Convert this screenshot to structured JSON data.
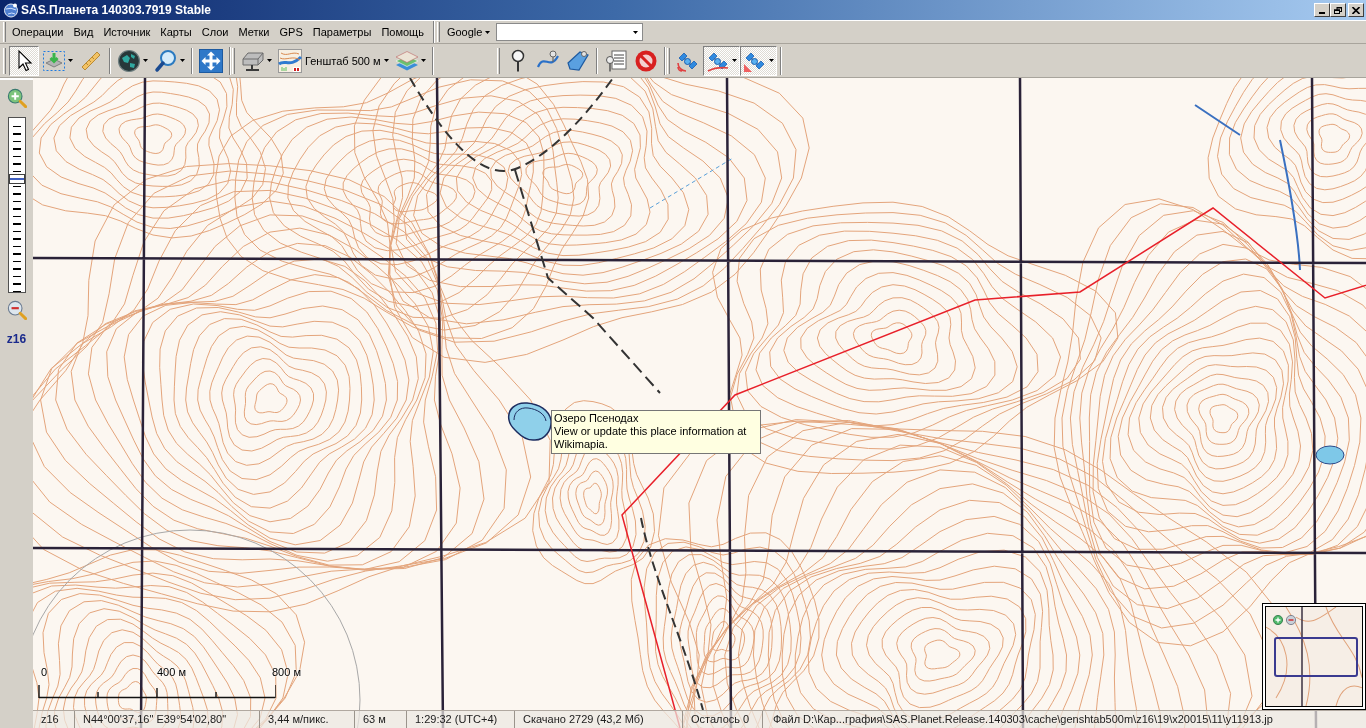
{
  "window": {
    "title": "SAS.Планета 140303.7919 Stable"
  },
  "menu": {
    "items": [
      "Операции",
      "Вид",
      "Источник",
      "Карты",
      "Слои",
      "Метки",
      "GPS",
      "Параметры",
      "Помощь"
    ]
  },
  "search_toolbar": {
    "provider": "Google"
  },
  "toolbars": [
    {
      "groups": [
        {
          "buttons": [
            {
              "pressed": true,
              "dropdown": false
            },
            {
              "pressed": false,
              "dropdown": true
            },
            {
              "pressed": false,
              "dropdown": false
            }
          ]
        },
        {
          "buttons": [
            {
              "pressed": false,
              "dropdown": true
            },
            {
              "pressed": false,
              "dropdown": true
            }
          ]
        },
        {
          "buttons": [
            {
              "pressed": false,
              "dropdown": false
            }
          ]
        }
      ]
    },
    {
      "groups": [
        {
          "buttons": [
            {
              "pressed": false,
              "dropdown": true
            },
            {
              "pressed": false,
              "dropdown": true,
              "label": "Генштаб 500 м"
            },
            {
              "pressed": false,
              "dropdown": true
            }
          ]
        }
      ]
    },
    {
      "groups": [
        {
          "buttons": [
            {
              "pressed": false,
              "dropdown": false
            },
            {
              "pressed": false,
              "dropdown": false
            },
            {
              "pressed": false,
              "dropdown": false
            }
          ]
        },
        {
          "buttons": [
            {
              "pressed": false,
              "dropdown": false
            },
            {
              "pressed": false,
              "dropdown": false
            }
          ]
        }
      ]
    },
    {
      "groups": [
        {
          "buttons": [
            {
              "pressed": false,
              "dropdown": false
            },
            {
              "pressed": true,
              "dropdown": true
            },
            {
              "pressed": true,
              "dropdown": true
            }
          ]
        }
      ]
    }
  ],
  "zoom_panel": {
    "slider": {
      "level": 0.65
    },
    "label": "z16"
  },
  "map": {
    "tooltip": {
      "title": "Озеро Псенодах",
      "text": "View or update this place information at Wikimapia."
    },
    "scale_bar": {
      "labels": [
        "0",
        "400 м",
        "800 м"
      ]
    }
  },
  "status_bar": {
    "items": [
      "z16",
      "N44°00'37,16\" E39°54'02,80\"",
      "3,44 м/пикс.",
      "63 м",
      "1:29:32 (UTC+4)",
      "Скачано 2729 (43,2 Мб)",
      "Осталось 0",
      "Файл D:\\Кар...графия\\SAS.Planet.Release.140303\\cache\\genshtab500m\\z16\\19\\x20015\\11\\y11913.jp"
    ]
  }
}
